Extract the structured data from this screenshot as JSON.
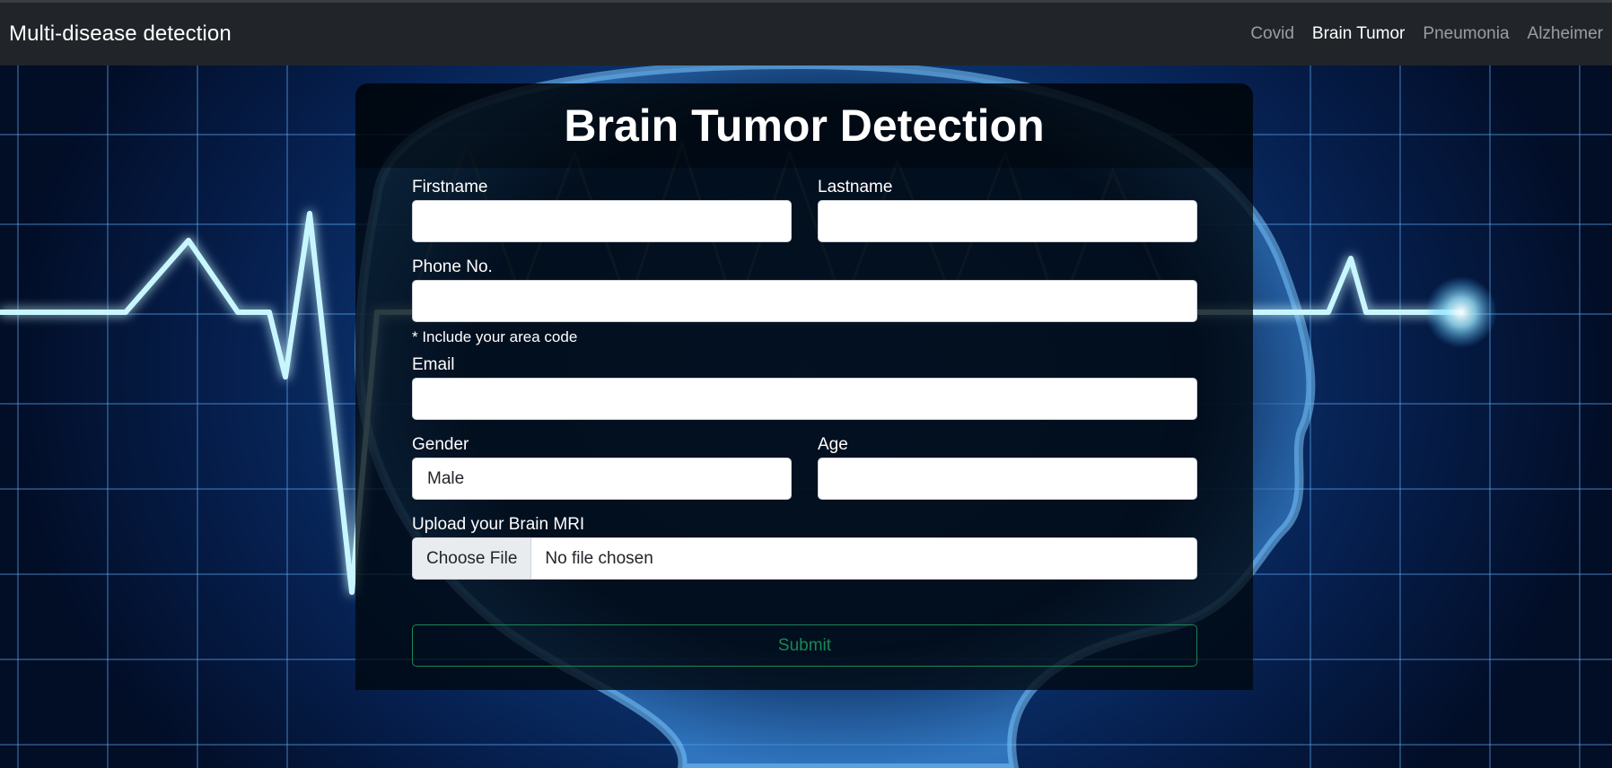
{
  "navbar": {
    "brand": "Multi-disease detection",
    "links": [
      {
        "label": "Covid",
        "active": false
      },
      {
        "label": "Brain Tumor",
        "active": true
      },
      {
        "label": "Pneumonia",
        "active": false
      },
      {
        "label": "Alzheimer",
        "active": false
      }
    ]
  },
  "form": {
    "title": "Brain Tumor Detection",
    "firstname_label": "Firstname",
    "firstname_value": "",
    "lastname_label": "Lastname",
    "lastname_value": "",
    "phone_label": "Phone No.",
    "phone_value": "",
    "phone_hint": "* Include your area code",
    "email_label": "Email",
    "email_value": "",
    "gender_label": "Gender",
    "gender_value": "Male",
    "age_label": "Age",
    "age_value": "",
    "upload_label": "Upload your Brain MRI",
    "upload_button": "Choose File",
    "upload_status": "No file chosen",
    "submit_label": "Submit"
  },
  "colors": {
    "navbar_bg": "#212529",
    "submit_accent": "#198754",
    "heartbeat": "#bff4ff"
  }
}
